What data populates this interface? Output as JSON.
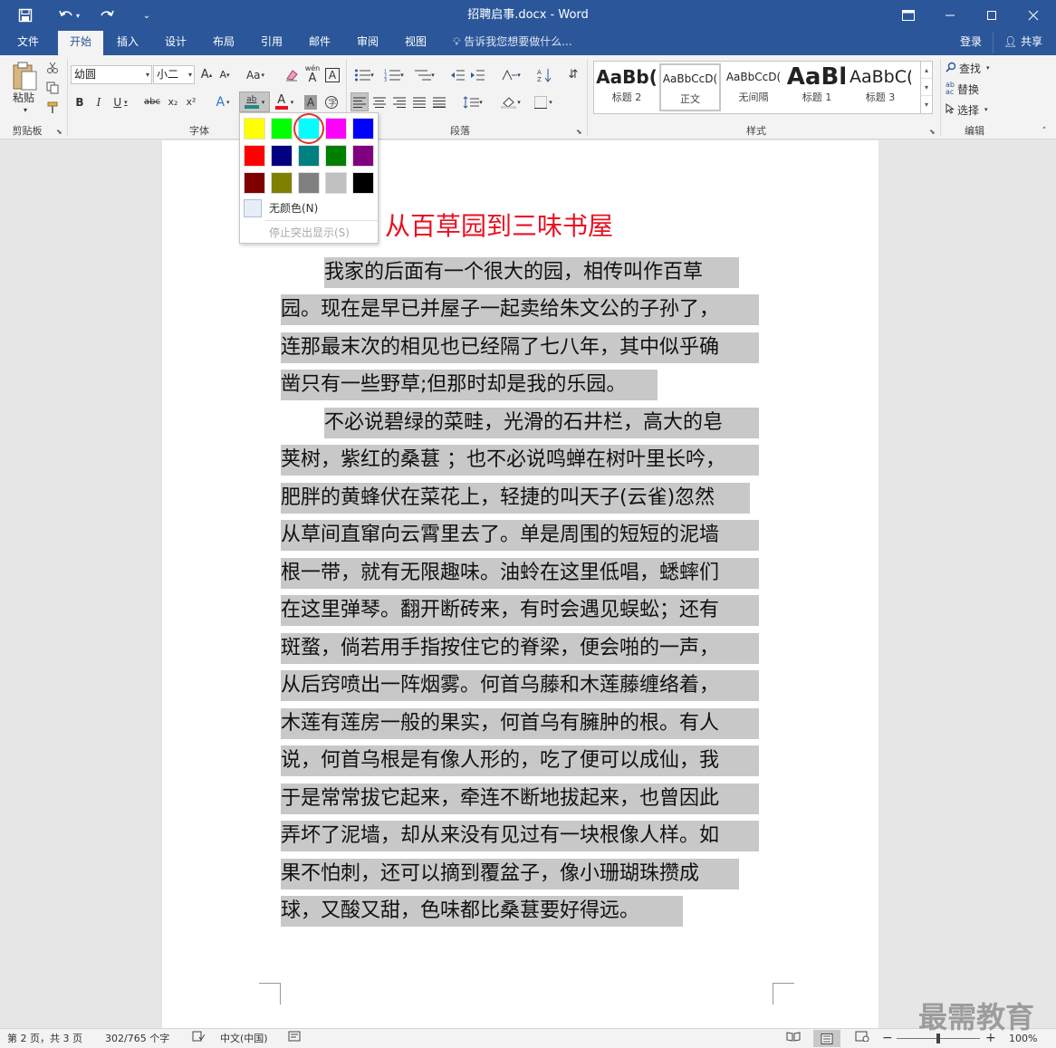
{
  "window": {
    "title": "招聘启事.docx - Word"
  },
  "tabs": [
    {
      "label": "文件"
    },
    {
      "label": "开始"
    },
    {
      "label": "插入"
    },
    {
      "label": "设计"
    },
    {
      "label": "布局"
    },
    {
      "label": "引用"
    },
    {
      "label": "邮件"
    },
    {
      "label": "审阅"
    },
    {
      "label": "视图"
    }
  ],
  "tellme": {
    "placeholder": "告诉我您想要做什么..."
  },
  "account": {
    "login": "登录",
    "share": "共享"
  },
  "clipboard": {
    "paste": "粘贴",
    "label": "剪贴板"
  },
  "font": {
    "name": "幼圆",
    "size": "小二",
    "label": "字体",
    "bold": "B",
    "italic": "I",
    "underline": "U",
    "strike": "abc",
    "sub": "x₂",
    "sup": "x²",
    "grow": "A",
    "shrink": "A",
    "case": "Aa",
    "effects": "A",
    "highlight": "ab",
    "fontcolor": "A",
    "shade": "A",
    "border": "A",
    "phonetic": "wén",
    "phonetic_char": "A"
  },
  "paragraph": {
    "label": "段落"
  },
  "styles": {
    "label": "样式",
    "items": [
      {
        "sample": "AaBb(",
        "name": "标题 2"
      },
      {
        "sample": "AaBbCcD(",
        "name": "正文"
      },
      {
        "sample": "AaBbCcD(",
        "name": "无间隔"
      },
      {
        "sample": "AaBl",
        "name": "标题 1"
      },
      {
        "sample": "AaBbC(",
        "name": "标题 3"
      }
    ]
  },
  "editing": {
    "label": "编辑",
    "find": "查找",
    "replace": "替换",
    "select": "选择"
  },
  "highlight_menu": {
    "colors": [
      "#ffff00",
      "#00ff00",
      "#00ffff",
      "#ff00ff",
      "#0000ff",
      "#ff0000",
      "#000080",
      "#008080",
      "#008000",
      "#800080",
      "#800000",
      "#808000",
      "#808080",
      "#c0c0c0",
      "#000000"
    ],
    "selected_index": 2,
    "no_color": "无颜色(N)",
    "stop": "停止突出显示(S)"
  },
  "document": {
    "heading": "从百草园到三味书屋",
    "lines": [
      "我家的后面有一个很大的园，相传叫作百草",
      "园。现在是早已并屋子一起卖给朱文公的子孙了，",
      "连那最末次的相见也已经隔了七八年，其中似乎确",
      "凿只有一些野草;但那时却是我的乐园。",
      "不必说碧绿的菜畦，光滑的石井栏，高大的皂",
      "荚树，紫红的桑葚 ；也不必说鸣蝉在树叶里长吟，",
      "肥胖的黄蜂伏在菜花上，轻捷的叫天子(云雀)忽然",
      "从草间直窜向云霄里去了。单是周围的短短的泥墙",
      "根一带，就有无限趣味。油蛉在这里低唱，蟋蟀们",
      "在这里弹琴。翻开断砖来，有时会遇见蜈蚣；还有",
      "斑蝥，倘若用手指按住它的脊梁，便会啪的一声，",
      "从后窍喷出一阵烟雾。何首乌藤和木莲藤缠络着，",
      "木莲有莲房一般的果实，何首乌有臃肿的根。有人",
      "说，何首乌根是有像人形的，吃了便可以成仙，我",
      "于是常常拔它起来，牵连不断地拔起来，也曾因此",
      "弄坏了泥墙，却从来没有见过有一块根像人样。如",
      "果不怕刺，还可以摘到覆盆子，像小珊瑚珠攒成",
      "球，又酸又甜，色味都比桑葚要好得远。"
    ]
  },
  "status": {
    "page": "第 2 页，共 3 页",
    "words": "302/765 个字",
    "lang": "中文(中国)",
    "zoom": "100%"
  },
  "watermark": "最需教育"
}
